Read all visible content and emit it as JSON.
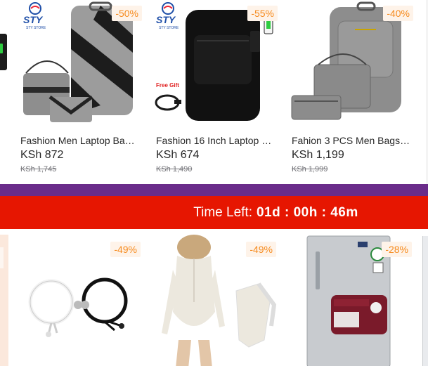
{
  "top_products": [
    {
      "name": "Fashion Men Laptop Ba…",
      "price": "KSh 872",
      "old_price": "KSh 1,745",
      "discount": "-50%",
      "brand": "STY",
      "brand_sub": "STY STORE"
    },
    {
      "name": "Fashion 16 Inch Laptop …",
      "price": "KSh 674",
      "old_price": "KSh 1,490",
      "discount": "-55%",
      "brand": "STY",
      "brand_sub": "STY STORE",
      "badge": "Free Gift"
    },
    {
      "name": "Fahion 3 PCS Men Bags…",
      "price": "KSh 1,199",
      "old_price": "KSh 1,999",
      "discount": "-40%"
    }
  ],
  "flash_sale": {
    "timer_label": "Time Left:",
    "timer_value": "01d : 00h : 46m",
    "accent_red": "#e61601",
    "accent_purple": "#6a2c8a"
  },
  "flash_products": [
    {
      "discount": "-49%",
      "image": "magnetic-couple-bracelets"
    },
    {
      "discount": "-49%",
      "image": "cream-zip-bodysuit"
    },
    {
      "discount": "-28%",
      "image": "silver-mini-fridge"
    }
  ],
  "colors": {
    "discount_text": "#f68b1e",
    "discount_bg": "#fef3e9"
  }
}
